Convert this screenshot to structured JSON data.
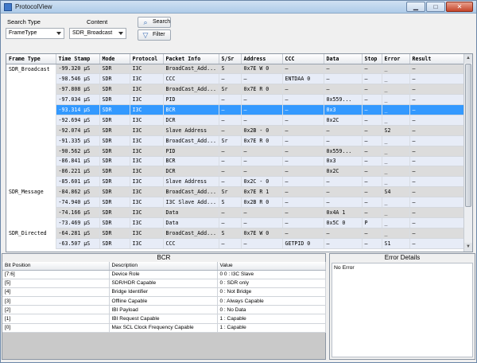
{
  "window": {
    "title": "ProtocolView"
  },
  "toolbar": {
    "search_type_label": "Search Type",
    "content_label": "Content",
    "search_type_value": "FrameType",
    "content_value": "SDR_Broadcast",
    "search_button": "Search",
    "filter_button": "Filter"
  },
  "grid": {
    "columns": [
      "Frame Type",
      "Time Stamp",
      "Mode",
      "Protocol",
      "Packet Info",
      "S/Sr",
      "Address",
      "CCC",
      "Data",
      "Stop",
      "Error",
      "Result"
    ],
    "rows": [
      [
        "SDR_Broadcast",
        "-99.320 µS",
        "SDR",
        "I3C",
        "BroadCast_Add...",
        "S",
        "0x7E W 0",
        "–",
        "–",
        "–",
        "_",
        "–"
      ],
      [
        "",
        "-98.546 µS",
        "SDR",
        "I3C",
        "CCC",
        "–",
        "–",
        "ENTDAA 0",
        "–",
        "–",
        "_",
        "–"
      ],
      [
        "",
        "-97.808 µS",
        "SDR",
        "I3C",
        "BroadCast_Add...",
        "Sr",
        "0x7E R 0",
        "–",
        "–",
        "–",
        "_",
        "–"
      ],
      [
        "",
        "-97.034 µS",
        "SDR",
        "I3C",
        "PID",
        "–",
        "–",
        "–",
        "0x559...",
        "–",
        "_",
        "–"
      ],
      [
        "",
        "-93.314 µS",
        "SDR",
        "I3C",
        "BCR",
        "–",
        "–",
        "–",
        "0x3",
        "–",
        "_",
        "–"
      ],
      [
        "",
        "-92.694 µS",
        "SDR",
        "I3C",
        "DCR",
        "–",
        "–",
        "–",
        "0x2C",
        "–",
        "_",
        "–"
      ],
      [
        "",
        "-92.074 µS",
        "SDR",
        "I3C",
        "Slave Address",
        "–",
        "0x2B - 0",
        "–",
        "–",
        "–",
        "S2",
        "–"
      ],
      [
        "",
        "-91.335 µS",
        "SDR",
        "I3C",
        "BroadCast_Add...",
        "Sr",
        "0x7E R 0",
        "–",
        "–",
        "–",
        "_",
        "–"
      ],
      [
        "",
        "-90.562 µS",
        "SDR",
        "I3C",
        "PID",
        "–",
        "–",
        "–",
        "0x559...",
        "–",
        "_",
        "–"
      ],
      [
        "",
        "-86.841 µS",
        "SDR",
        "I3C",
        "BCR",
        "–",
        "–",
        "–",
        "0x3",
        "–",
        "_",
        "–"
      ],
      [
        "",
        "-86.221 µS",
        "SDR",
        "I3C",
        "DCR",
        "–",
        "–",
        "–",
        "0x2C",
        "–",
        "_",
        "–"
      ],
      [
        "",
        "-85.601 µS",
        "SDR",
        "I3C",
        "Slave Address",
        "–",
        "0x2C - 0",
        "–",
        "–",
        "–",
        "_",
        "–"
      ],
      [
        "SDR_Message",
        "-84.862 µS",
        "SDR",
        "I3C",
        "BroadCast_Add...",
        "Sr",
        "0x7E R 1",
        "–",
        "–",
        "–",
        "S4",
        "–"
      ],
      [
        "",
        "-74.940 µS",
        "SDR",
        "I3C",
        "I3C Slave Add...",
        "S",
        "0x2B R 0",
        "–",
        "–",
        "–",
        "_",
        "–"
      ],
      [
        "",
        "-74.166 µS",
        "SDR",
        "I3C",
        "Data",
        "–",
        "–",
        "–",
        "0x4A 1",
        "–",
        "_",
        "–"
      ],
      [
        "",
        "-73.469 µS",
        "SDR",
        "I3C",
        "Data",
        "–",
        "–",
        "–",
        "0x5C 0",
        "P",
        "_",
        "–"
      ],
      [
        "SDR_Directed",
        "-64.281 µS",
        "SDR",
        "I3C",
        "BroadCast_Add...",
        "S",
        "0x7E W 0",
        "–",
        "–",
        "–",
        "_",
        "–"
      ],
      [
        "",
        "-63.507 µS",
        "SDR",
        "I3C",
        "CCC",
        "–",
        "–",
        "GETPID 0",
        "–",
        "–",
        "S1",
        "–"
      ]
    ],
    "selected_row_index": 4
  },
  "bcr": {
    "title": "BCR",
    "columns": [
      "Bit Position",
      "Description",
      "Value"
    ],
    "rows": [
      [
        "[7:6]",
        "Device Role",
        "0 0 : I3C Slave"
      ],
      [
        "[5]",
        "SDR/HDR Capable",
        "0 : SDR only"
      ],
      [
        "[4]",
        "Bridge Identifier",
        "0 : Not Bridge"
      ],
      [
        "[3]",
        "Offline Capable",
        "0 : Always Capable"
      ],
      [
        "[2]",
        "IBI Payload",
        "0 : No Data"
      ],
      [
        "[1]",
        "IBI Request Capable",
        "1 : Capable"
      ],
      [
        "[0]",
        "Max SCL Clock Frequency Capable",
        "1 : Capable"
      ]
    ]
  },
  "error_details": {
    "title": "Error Details",
    "text": "No Error"
  },
  "colors": {
    "selection": "#3399ff",
    "row_odd": "#dcdcdc",
    "row_even": "#e7ecf7"
  }
}
